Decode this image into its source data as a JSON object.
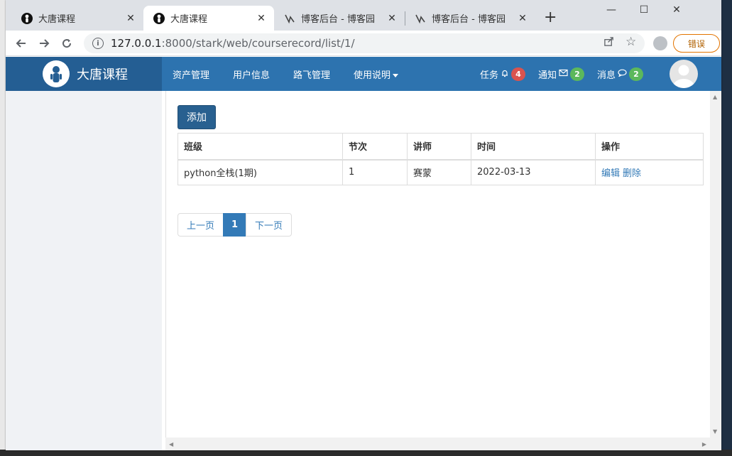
{
  "colors": {
    "navbar": "#2d73af",
    "brand_bg": "#245e93",
    "primary": "#286090",
    "link": "#337ab7",
    "badge_red": "#d9534f",
    "badge_green": "#5cb85c"
  },
  "browser": {
    "tabs": [
      {
        "title": "大唐课程",
        "icon": "person-favicon-icon"
      },
      {
        "title": "大唐课程",
        "icon": "person-favicon-icon"
      },
      {
        "title": "博客后台 - 博客园",
        "icon": "cnblogs-favicon-icon"
      },
      {
        "title": "博客后台 - 博客园",
        "icon": "cnblogs-favicon-icon"
      }
    ],
    "url_host": "127.0.0.1",
    "url_rest": ":8000/stark/web/courserecord/list/1/",
    "error_label": "错误"
  },
  "site": {
    "brand": "大唐课程",
    "menu": [
      "资产管理",
      "用户信息",
      "路飞管理",
      "使用说明"
    ],
    "right": [
      {
        "label": "任务",
        "icon": "bell-icon",
        "count": "4"
      },
      {
        "label": "通知",
        "icon": "envelope-icon",
        "count": "2"
      },
      {
        "label": "消息",
        "icon": "comment-icon",
        "count": "2"
      }
    ]
  },
  "page": {
    "add_label": "添加",
    "table": {
      "headers": [
        "班级",
        "节次",
        "讲师",
        "时间",
        "操作"
      ],
      "rows": [
        {
          "cls": "python全栈(1期)",
          "num": "1",
          "teacher": "赛蒙",
          "date": "2022-03-13",
          "edit": "编辑",
          "del": "删除"
        }
      ]
    },
    "pager": {
      "prev": "上一页",
      "current": "1",
      "next": "下一页"
    }
  }
}
